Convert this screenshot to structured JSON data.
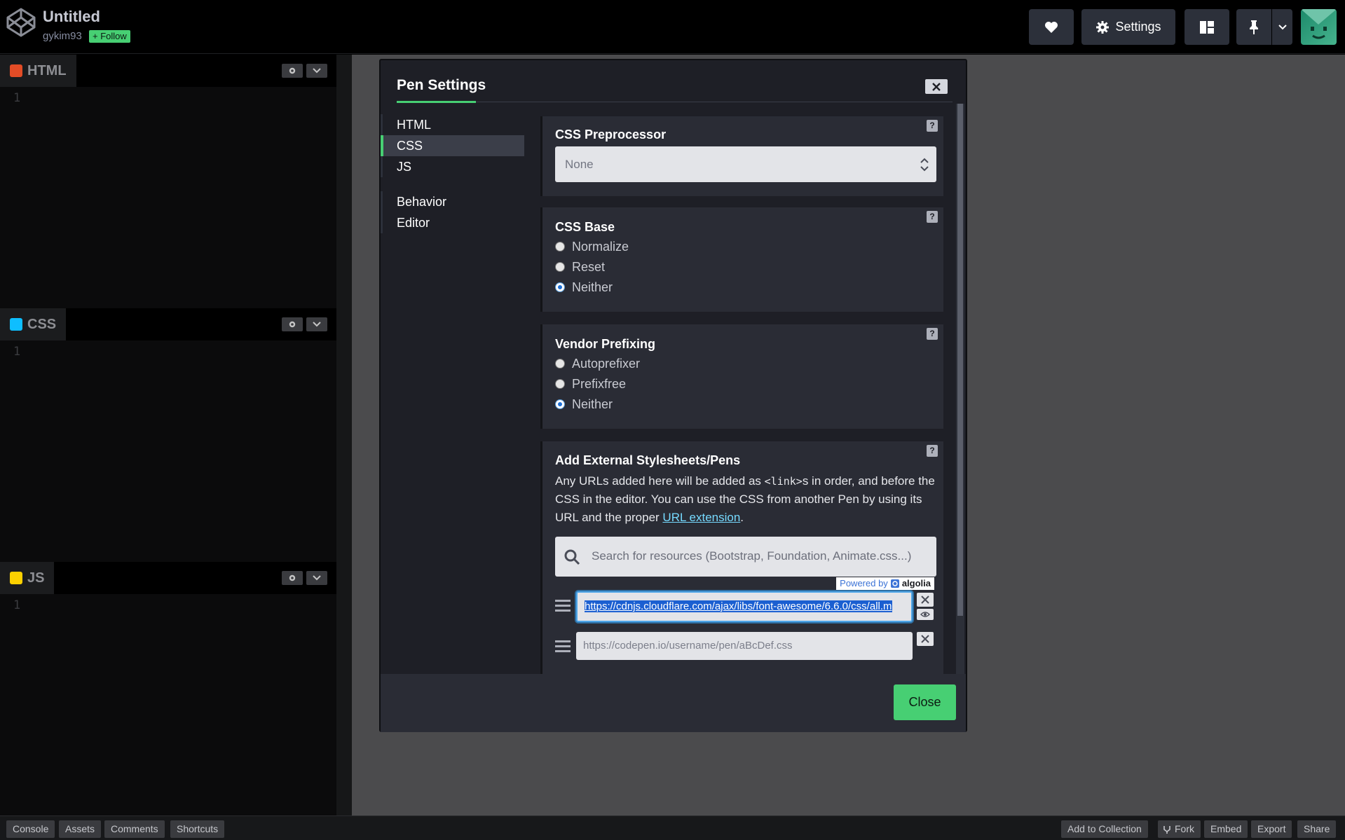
{
  "header": {
    "pen_title": "Untitled",
    "username": "gykim93",
    "follow_label": "+ Follow",
    "settings_label": "Settings"
  },
  "editors": [
    {
      "name": "HTML",
      "line": "1",
      "color": "#e34c26"
    },
    {
      "name": "CSS",
      "line": "1",
      "color": "#0ebeff"
    },
    {
      "name": "JS",
      "line": "1",
      "color": "#fcd000"
    }
  ],
  "footer": {
    "left": [
      "Console",
      "Assets",
      "Comments",
      "Shortcuts"
    ],
    "right": [
      "Add to Collection",
      "Fork",
      "Embed",
      "Export",
      "Share"
    ]
  },
  "modal": {
    "title": "Pen Settings",
    "nav_group1": [
      "HTML",
      "CSS",
      "JS"
    ],
    "nav_group2": [
      "Behavior",
      "Editor"
    ],
    "active_nav": "CSS",
    "preprocessor": {
      "title": "CSS Preprocessor",
      "value": "None"
    },
    "css_base": {
      "title": "CSS Base",
      "options": [
        "Normalize",
        "Reset",
        "Neither"
      ],
      "selected": "Neither"
    },
    "vendor": {
      "title": "Vendor Prefixing",
      "options": [
        "Autoprefixer",
        "Prefixfree",
        "Neither"
      ],
      "selected": "Neither"
    },
    "external": {
      "title": "Add External Stylesheets/Pens",
      "desc_before": "Any URLs added here will be added as ",
      "desc_code": "<link>",
      "desc_middle": "s in order, and before the CSS in the editor. You can use the CSS from another Pen by using its URL and the proper ",
      "desc_link": "URL extension",
      "desc_after": ".",
      "search_placeholder": "Search for resources (Bootstrap, Foundation, Animate.css...)",
      "powered_by": "Powered by",
      "powered_brand": "algolia",
      "url1_value": "https://cdnjs.cloudflare.com/ajax/libs/font-awesome/6.6.0/css/all.m",
      "url2_placeholder": "https://codepen.io/username/pen/aBcDef.css"
    },
    "help_label": "?",
    "close_label": "Close"
  },
  "colors": {
    "accent": "#47cf73",
    "link": "#76daff",
    "selection": "#1b5fd1"
  }
}
